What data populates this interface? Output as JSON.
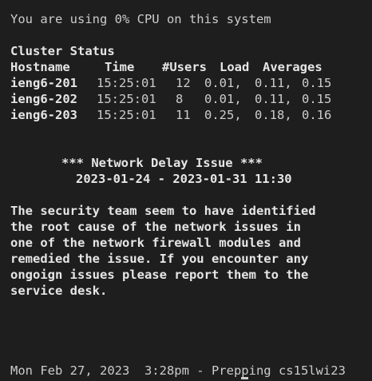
{
  "terminal": {
    "cpu_line": "You are using 0% CPU on this system",
    "cluster": {
      "title": "Cluster Status",
      "headers": [
        "Hostname",
        "Time",
        "#Users",
        "Load",
        "Averages"
      ],
      "rows": [
        {
          "host": "ieng6-201",
          "time": "15:25:01",
          "users": "12",
          "l1": "0.01,",
          "l5": "0.11,",
          "l15": "0.15"
        },
        {
          "host": "ieng6-202",
          "time": "15:25:01",
          "users": "8",
          "l1": "0.01,",
          "l5": "0.11,",
          "l15": "0.15"
        },
        {
          "host": "ieng6-203",
          "time": "15:25:01",
          "users": "11",
          "l1": "0.25,",
          "l5": "0.18,",
          "l15": "0.16"
        }
      ]
    },
    "notice": {
      "title": "*** Network Delay Issue ***",
      "dates": "2023-01-24 - 2023-01-31 11:30",
      "body": [
        "The security team seem to have identified",
        "the root cause of the network issues in",
        "one of the network firewall modules and",
        "remedied the issue. If you encounter any",
        "ongoign issues please report them to the",
        "service desk."
      ]
    },
    "status_line": "Mon Feb 27, 2023  3:28pm - Prepping cs15lwi23"
  },
  "colors": {
    "background": "#1e1e1e",
    "text": "#cccccc",
    "bold_text": "#e6e6e6"
  }
}
